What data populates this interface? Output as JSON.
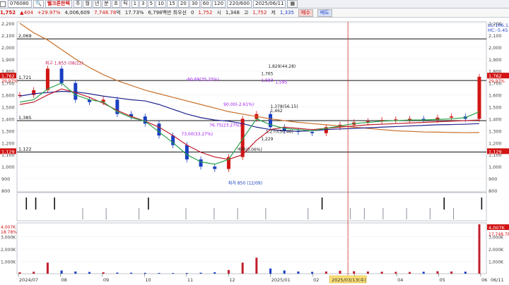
{
  "toolbar": {
    "code": "076080",
    "name": "웰크론한텍",
    "periods": [
      "주",
      "월",
      "년",
      "분",
      "초",
      "틱"
    ],
    "intervals": [
      "1",
      "3",
      "5",
      "10",
      "15",
      "20",
      "30",
      "60",
      "120"
    ],
    "count": "220/600",
    "date": "2025/06/11"
  },
  "quote": {
    "price": "1,752",
    "change": "404",
    "change_pct": "+29.97%",
    "volume": "4,006,609",
    "amount": "7,748.78",
    "amount_unit": "억",
    "turnover": "17.73%",
    "prev_volume": "6,798",
    "prev_volume_unit": "백만",
    "prev_volume_label": "최우선",
    "pref_value": "0",
    "sise_label": "시",
    "open": "1,752",
    "high_label": "고",
    "high": "1,348",
    "low_label": "저",
    "high2": "1,752",
    "low": "1,335",
    "buy_label": "매수",
    "sell_label": "매도"
  },
  "chart_data": {
    "type": "line",
    "title": "",
    "price_axis": {
      "ylim": [
        800,
        2200
      ],
      "ticks": [
        "800",
        "900",
        "1,000",
        "1,100",
        "1,200",
        "1,300",
        "1,400",
        "1,500",
        "1,600",
        "1,700",
        "1,800",
        "1,900",
        "2,000",
        "2,100",
        "2,200"
      ]
    },
    "x_labels": [
      "2024/07",
      "08",
      "09",
      "10",
      "11",
      "12",
      "2025/01",
      "02",
      "03",
      "04",
      "05",
      "06"
    ],
    "cursor_date": "2025/03/13(수)",
    "right_last_label": "06/11",
    "ma_legend": [
      "LC:106.13",
      "HC:-5.45"
    ],
    "horizontal_lines": [
      {
        "value": 2069,
        "label": "2,069"
      },
      {
        "value": 1721,
        "label": "1,721"
      },
      {
        "value": 1385,
        "label": "1,385"
      },
      {
        "value": 1122,
        "label": "1,122"
      }
    ],
    "right_markers": [
      {
        "value": 1762,
        "label": "1,762",
        "sub": "29.97%",
        "color": "#d21414"
      },
      {
        "value": 1129,
        "label": "1,129",
        "color": "#d21414"
      }
    ],
    "left_markers": [
      {
        "value": 1762,
        "label": "1,762",
        "sub": "29.97%",
        "color": "#d21414"
      },
      {
        "value": 1129,
        "label": "1,129",
        "color": "#d21414"
      }
    ],
    "annotations": [
      {
        "text": "최고 1,853 (08/22)",
        "x_frac": 0.06,
        "value": 1853,
        "color": "#c2185b"
      },
      {
        "text": "최저 850 (12/09)",
        "x_frac": 0.45,
        "value": 850,
        "color": "#1a3fc2"
      },
      {
        "text": "1,829(44.28)",
        "x_frac": 0.535,
        "value": 1829,
        "color": "#222"
      },
      {
        "text": "1,765",
        "x_frac": 0.52,
        "value": 1765,
        "color": "#222"
      },
      {
        "text": "-60.69(35.25%)",
        "x_frac": 0.36,
        "value": 1720,
        "color": "#a020f0"
      },
      {
        "text": "1,595",
        "x_frac": 0.55,
        "value": 1695,
        "color": "#a020f0"
      },
      {
        "text": "1,583",
        "x_frac": 0.52,
        "value": 1710,
        "color": "#a020f0"
      },
      {
        "text": "90.00(-2.61%)",
        "x_frac": 0.44,
        "value": 1510,
        "color": "#a020f0"
      },
      {
        "text": "1,378(56.15)",
        "x_frac": 0.54,
        "value": 1490,
        "color": "#222"
      },
      {
        "text": "1,462",
        "x_frac": 0.54,
        "value": 1455,
        "color": "#222"
      },
      {
        "text": "76.75(23.27%)",
        "x_frac": 0.41,
        "value": 1335,
        "color": "#a020f0"
      },
      {
        "text": "1,270(50.46)",
        "x_frac": 0.53,
        "value": 1280,
        "color": "#222"
      },
      {
        "text": "73.00(33.27%)",
        "x_frac": 0.35,
        "value": 1260,
        "color": "#a020f0"
      },
      {
        "text": "1,229",
        "x_frac": 0.52,
        "value": 1220,
        "color": "#222"
      },
      {
        "text": "베타(0.06%)",
        "x_frac": 0.47,
        "value": 1130,
        "color": "#222"
      }
    ],
    "series": [
      {
        "name": "",
        "color": "#c8702a",
        "values": [
          2200,
          2120,
          2060,
          1980,
          1900,
          1830,
          1770,
          1720,
          1680,
          1640,
          1610,
          1580,
          1550,
          1520,
          1490,
          1460,
          1440,
          1420,
          1400,
          1385,
          1370,
          1360,
          1350,
          1340,
          1330,
          1320,
          1310,
          1300,
          1295,
          1290,
          1288,
          1286,
          1284,
          1285
        ]
      },
      {
        "name": "",
        "color": "#20248c",
        "values": [
          1590,
          1610,
          1620,
          1630,
          1625,
          1610,
          1590,
          1575,
          1560,
          1550,
          1520,
          1480,
          1440,
          1410,
          1390,
          1380,
          1360,
          1330,
          1310,
          1300,
          1295,
          1300,
          1310,
          1315,
          1320,
          1325,
          1330,
          1335,
          1340,
          1345,
          1350,
          1352,
          1355,
          1360
        ]
      },
      {
        "name": "",
        "color": "#c01e2c",
        "values": [
          1520,
          1540,
          1600,
          1650,
          1620,
          1580,
          1530,
          1470,
          1420,
          1380,
          1330,
          1260,
          1180,
          1120,
          1080,
          1060,
          1100,
          1220,
          1310,
          1330,
          1320,
          1310,
          1320,
          1330,
          1340,
          1350,
          1355,
          1360,
          1365,
          1370,
          1375,
          1380,
          1385,
          1390
        ]
      },
      {
        "name": "",
        "color": "#2aa34a",
        "values": [
          1540,
          1560,
          1650,
          1700,
          1600,
          1560,
          1540,
          1460,
          1410,
          1380,
          1290,
          1200,
          1100,
          1040,
          1020,
          1060,
          1230,
          1400,
          1350,
          1320,
          1310,
          1300,
          1320,
          1340,
          1360,
          1370,
          1380,
          1385,
          1390,
          1390,
          1395,
          1400,
          1410,
          1460
        ]
      }
    ],
    "closes": [
      1600,
      1640,
      1820,
      1700,
      1560,
      1540,
      1560,
      1440,
      1420,
      1360,
      1260,
      1180,
      1060,
      1000,
      980,
      1080,
      1400,
      1440,
      1330,
      1300,
      1290,
      1280,
      1330,
      1350,
      1370,
      1380,
      1390,
      1395,
      1400,
      1390,
      1410,
      1420,
      1400,
      1752
    ],
    "signal_panel": {
      "strong": [
        0.02,
        0.04,
        0.08,
        0.28,
        0.65,
        0.91,
        0.99
      ],
      "weak": [
        0.14,
        0.19,
        0.26,
        0.36,
        0.42,
        0.47,
        0.53,
        0.62,
        0.71,
        0.74,
        0.78,
        0.83,
        0.88,
        0.93
      ]
    },
    "volume_panel": {
      "ylim": [
        0,
        4000000
      ],
      "ticks": [
        "1,000K",
        "2,000K",
        "3,000K"
      ],
      "last_label": "4,007K",
      "last_sub": "17,748.78",
      "left_top_label": "4,007K",
      "left_top_sub": "18.78%",
      "values": [
        120,
        160,
        900,
        260,
        180,
        140,
        120,
        90,
        80,
        70,
        60,
        55,
        60,
        80,
        120,
        300,
        900,
        1300,
        420,
        260,
        180,
        150,
        180,
        240,
        200,
        180,
        160,
        150,
        140,
        160,
        200,
        180,
        170,
        4007
      ]
    }
  }
}
